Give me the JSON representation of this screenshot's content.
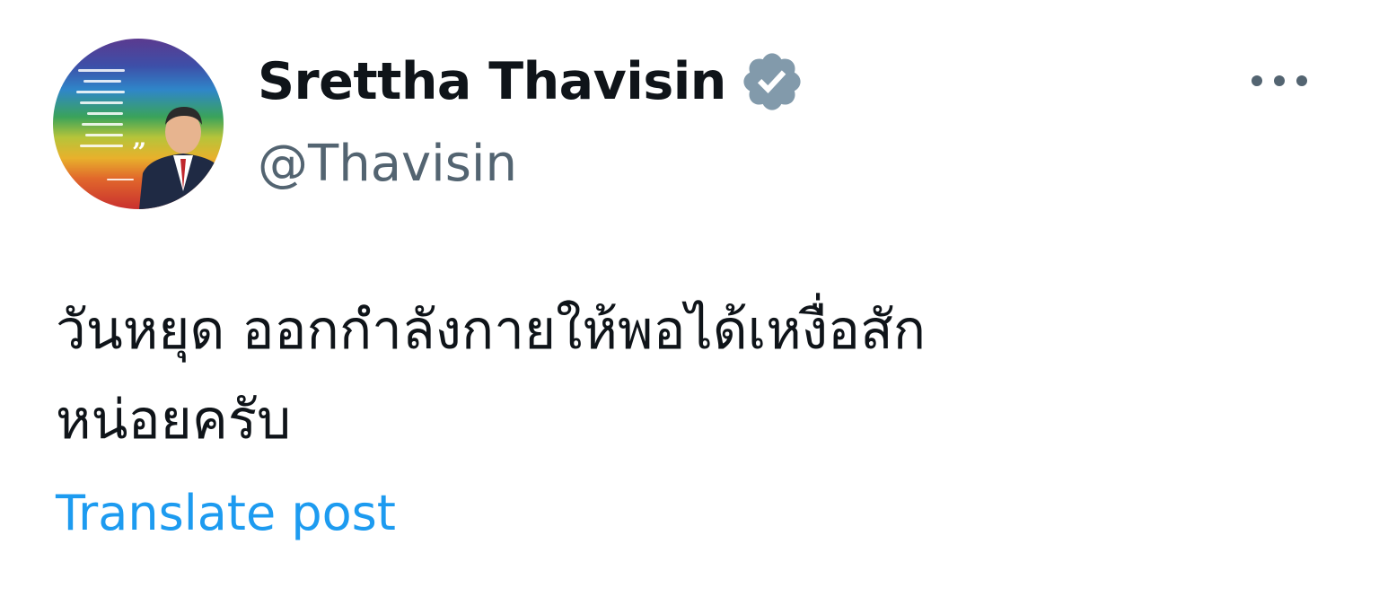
{
  "post": {
    "author": {
      "display_name": "Srettha Thavisin",
      "handle": "@Thavisin",
      "verified": true,
      "avatar_icon": "profile-photo"
    },
    "more_icon": "more-horizontal-icon",
    "text_lines": [
      "วันหยุด ออกกำลังกายให้พอได้เหงื่อสัก",
      "หน่อยครับ"
    ],
    "translate_label": "Translate post"
  },
  "colors": {
    "text": "#0f1419",
    "secondary": "#536471",
    "link": "#1d9bf0",
    "verified_badge": "#829aab"
  }
}
